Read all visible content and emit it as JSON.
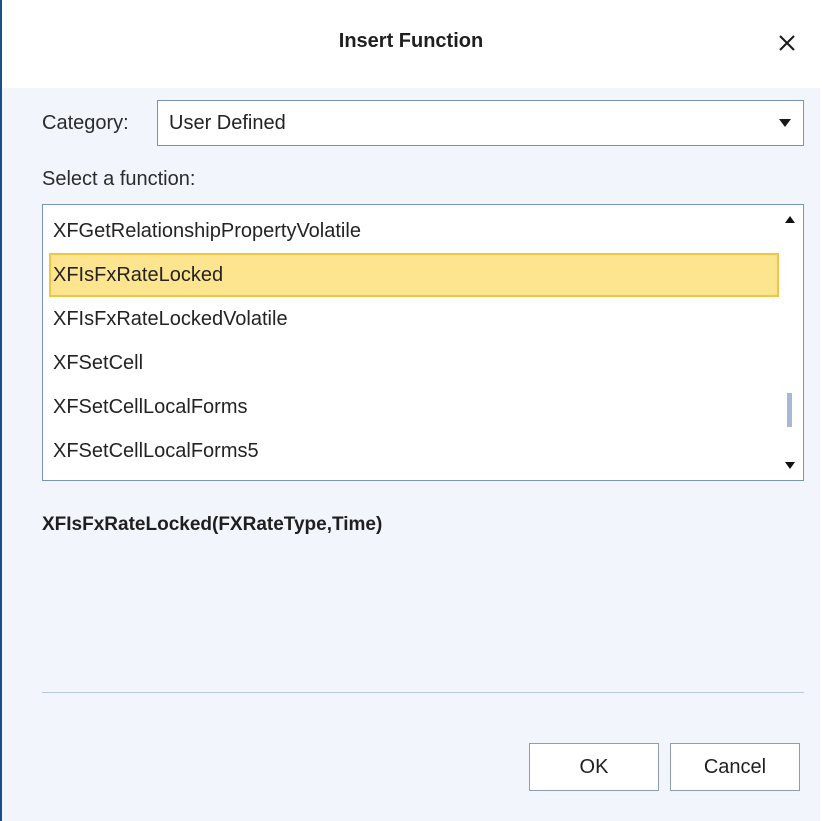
{
  "dialog": {
    "title": "Insert Function",
    "close_icon": "close-icon"
  },
  "category": {
    "label": "Category:",
    "selected": "User Defined"
  },
  "function_list": {
    "label": "Select a function:",
    "items": [
      "XFGetRelationshipPropertyVolatile",
      "XFIsFxRateLocked",
      "XFIsFxRateLockedVolatile",
      "XFSetCell",
      "XFSetCellLocalForms",
      "XFSetCellLocalForms5"
    ],
    "selected": "XFIsFxRateLocked"
  },
  "signature": "XFIsFxRateLocked(FXRateType,Time)",
  "buttons": {
    "ok": "OK",
    "cancel": "Cancel"
  },
  "colors": {
    "selection_fill": "#fde58f",
    "selection_border": "#f0c445",
    "accent_border": "#1b4f8a"
  }
}
